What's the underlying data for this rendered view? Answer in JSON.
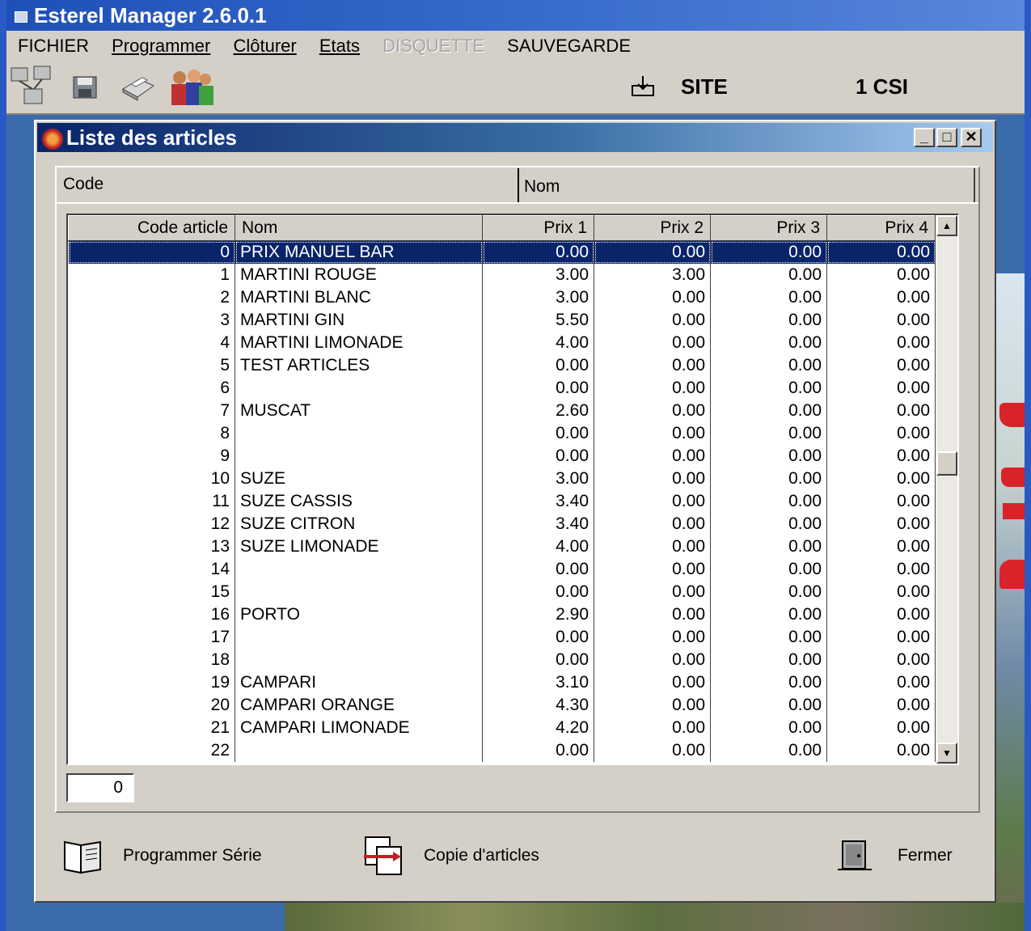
{
  "app": {
    "title": "Esterel Manager 2.6.0.1",
    "menu": [
      "FICHIER",
      "Programmer",
      "Clôturer",
      "Etats",
      "DISQUETTE",
      "SAUVEGARDE"
    ],
    "site_label": "SITE",
    "site_value": "1 CSI"
  },
  "dialog": {
    "title": "Liste des articles",
    "filter": {
      "code_label": "Code",
      "nom_label": "Nom"
    },
    "columns": [
      "Code article",
      "Nom",
      "Prix 1",
      "Prix 2",
      "Prix 3",
      "Prix 4"
    ],
    "rows": [
      [
        "0",
        "PRIX MANUEL BAR",
        "0.00",
        "0.00",
        "0.00",
        "0.00"
      ],
      [
        "1",
        "MARTINI ROUGE",
        "3.00",
        "3.00",
        "0.00",
        "0.00"
      ],
      [
        "2",
        "MARTINI BLANC",
        "3.00",
        "0.00",
        "0.00",
        "0.00"
      ],
      [
        "3",
        "MARTINI GIN",
        "5.50",
        "0.00",
        "0.00",
        "0.00"
      ],
      [
        "4",
        "MARTINI LIMONADE",
        "4.00",
        "0.00",
        "0.00",
        "0.00"
      ],
      [
        "5",
        "TEST ARTICLES",
        "0.00",
        "0.00",
        "0.00",
        "0.00"
      ],
      [
        "6",
        "",
        "0.00",
        "0.00",
        "0.00",
        "0.00"
      ],
      [
        "7",
        "MUSCAT",
        "2.60",
        "0.00",
        "0.00",
        "0.00"
      ],
      [
        "8",
        "",
        "0.00",
        "0.00",
        "0.00",
        "0.00"
      ],
      [
        "9",
        "",
        "0.00",
        "0.00",
        "0.00",
        "0.00"
      ],
      [
        "10",
        "SUZE",
        "3.00",
        "0.00",
        "0.00",
        "0.00"
      ],
      [
        "11",
        "SUZE CASSIS",
        "3.40",
        "0.00",
        "0.00",
        "0.00"
      ],
      [
        "12",
        "SUZE CITRON",
        "3.40",
        "0.00",
        "0.00",
        "0.00"
      ],
      [
        "13",
        "SUZE LIMONADE",
        "4.00",
        "0.00",
        "0.00",
        "0.00"
      ],
      [
        "14",
        "",
        "0.00",
        "0.00",
        "0.00",
        "0.00"
      ],
      [
        "15",
        "",
        "0.00",
        "0.00",
        "0.00",
        "0.00"
      ],
      [
        "16",
        "PORTO",
        "2.90",
        "0.00",
        "0.00",
        "0.00"
      ],
      [
        "17",
        "",
        "0.00",
        "0.00",
        "0.00",
        "0.00"
      ],
      [
        "18",
        "",
        "0.00",
        "0.00",
        "0.00",
        "0.00"
      ],
      [
        "19",
        "CAMPARI",
        "3.10",
        "0.00",
        "0.00",
        "0.00"
      ],
      [
        "20",
        "CAMPARI ORANGE",
        "4.30",
        "0.00",
        "0.00",
        "0.00"
      ],
      [
        "21",
        "CAMPARI LIMONADE",
        "4.20",
        "0.00",
        "0.00",
        "0.00"
      ],
      [
        "22",
        "",
        "0.00",
        "0.00",
        "0.00",
        "0.00"
      ]
    ],
    "selected_row": 0,
    "current_code": "0",
    "buttons": {
      "programmer_serie": "Programmer Série",
      "copie_articles": "Copie d'articles",
      "fermer": "Fermer"
    }
  },
  "colors": {
    "selection": "#0a246a",
    "title_bar": "#1e50b8",
    "face": "#d4d0c8"
  }
}
